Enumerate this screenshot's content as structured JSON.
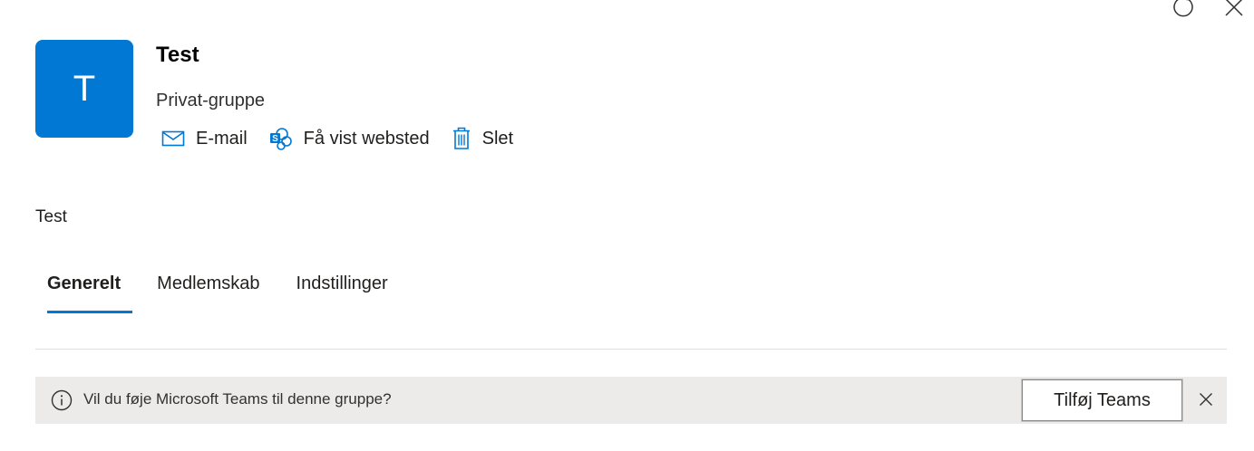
{
  "header": {
    "avatar_initial": "T",
    "group_name": "Test",
    "group_type": "Privat-gruppe",
    "actions": [
      {
        "label": "E-mail",
        "icon": "mail-icon"
      },
      {
        "label": "Få vist websted",
        "icon": "sharepoint-icon"
      },
      {
        "label": "Slet",
        "icon": "trash-icon"
      }
    ]
  },
  "window_controls": {
    "refresh_icon": "refresh-icon",
    "close_icon": "close-icon"
  },
  "description": "Test",
  "tabs": [
    {
      "label": "Generelt",
      "active": true
    },
    {
      "label": "Medlemskab",
      "active": false
    },
    {
      "label": "Indstillinger",
      "active": false
    }
  ],
  "message_bar": {
    "icon": "info-icon",
    "text": "Vil du føje Microsoft Teams til denne gruppe?",
    "button_label": "Tilføj Teams",
    "dismiss_icon": "dismiss-icon"
  },
  "colors": {
    "accent": "#0078d4",
    "message_bar_bg": "#edebe9",
    "divider": "#e1dfdd"
  }
}
